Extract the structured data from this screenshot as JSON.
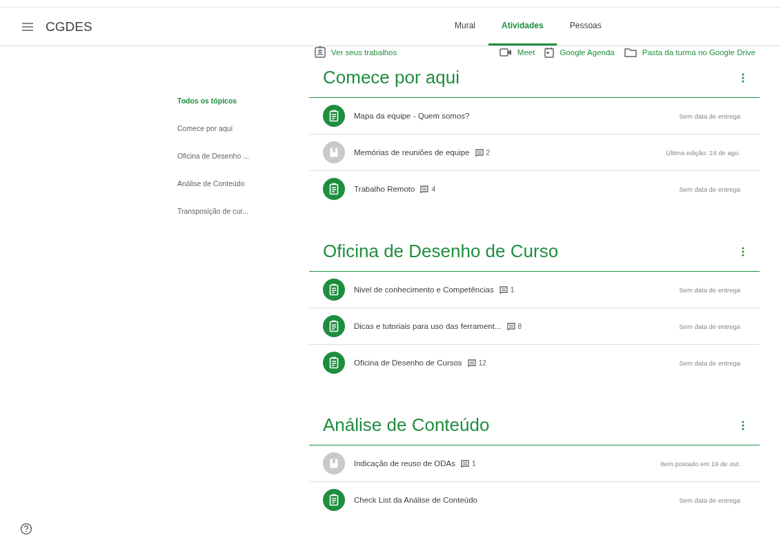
{
  "header": {
    "class_name": "CGDES",
    "tabs": [
      {
        "label": "Mural",
        "selected": false
      },
      {
        "label": "Atividades",
        "selected": true
      },
      {
        "label": "Pessoas",
        "selected": false
      }
    ]
  },
  "toolbar": {
    "your_work": "Ver seus trabalhos",
    "links": [
      {
        "kind": "video",
        "label": "Meet"
      },
      {
        "kind": "calendar",
        "label": "Google Agenda"
      },
      {
        "kind": "folder",
        "label": "Pasta da turma no Google Drive"
      }
    ]
  },
  "sidebar": {
    "items": [
      {
        "label": "Todos os tópicos",
        "selected": true
      },
      {
        "label": "Comece por aqui",
        "selected": false
      },
      {
        "label": "Oficina de Desenho ...",
        "selected": false
      },
      {
        "label": "Análise de Conteúdo",
        "selected": false
      },
      {
        "label": "Transposição de cur...",
        "selected": false
      }
    ]
  },
  "topics": [
    {
      "title": "Comece por aqui",
      "items": [
        {
          "kind": "assignment",
          "title": "Mapa da equipe - Quem somos?",
          "status": "Sem data de entrega"
        },
        {
          "kind": "material",
          "title": "Memórias de reuniões de equipe",
          "comments": "2",
          "status": "Última edição: 24 de ago."
        },
        {
          "kind": "assignment",
          "title": "Trabalho Remoto",
          "comments": "4",
          "status": "Sem data de entrega"
        }
      ]
    },
    {
      "title": "Oficina de Desenho de Curso",
      "items": [
        {
          "kind": "assignment",
          "title": "Nivel de conhecimento e Competências",
          "comments": "1",
          "status": "Sem data de entrega"
        },
        {
          "kind": "assignment",
          "title": "Dicas e tutoriais para uso das ferrament...",
          "comments": "8",
          "status": "Sem data de entrega"
        },
        {
          "kind": "assignment",
          "title": "Oficina de Desenho de Cursos",
          "comments": "12",
          "status": "Sem data de entrega"
        }
      ]
    },
    {
      "title": "Análise de Conteúdo",
      "items": [
        {
          "kind": "material",
          "title": "Indicação de reuso de ODAs",
          "comments": "1",
          "status": "Item postado em 19 de out."
        },
        {
          "kind": "assignment",
          "title": "Check List da Análise de Conteúdo",
          "status": "Sem data de entrega"
        }
      ]
    }
  ]
}
